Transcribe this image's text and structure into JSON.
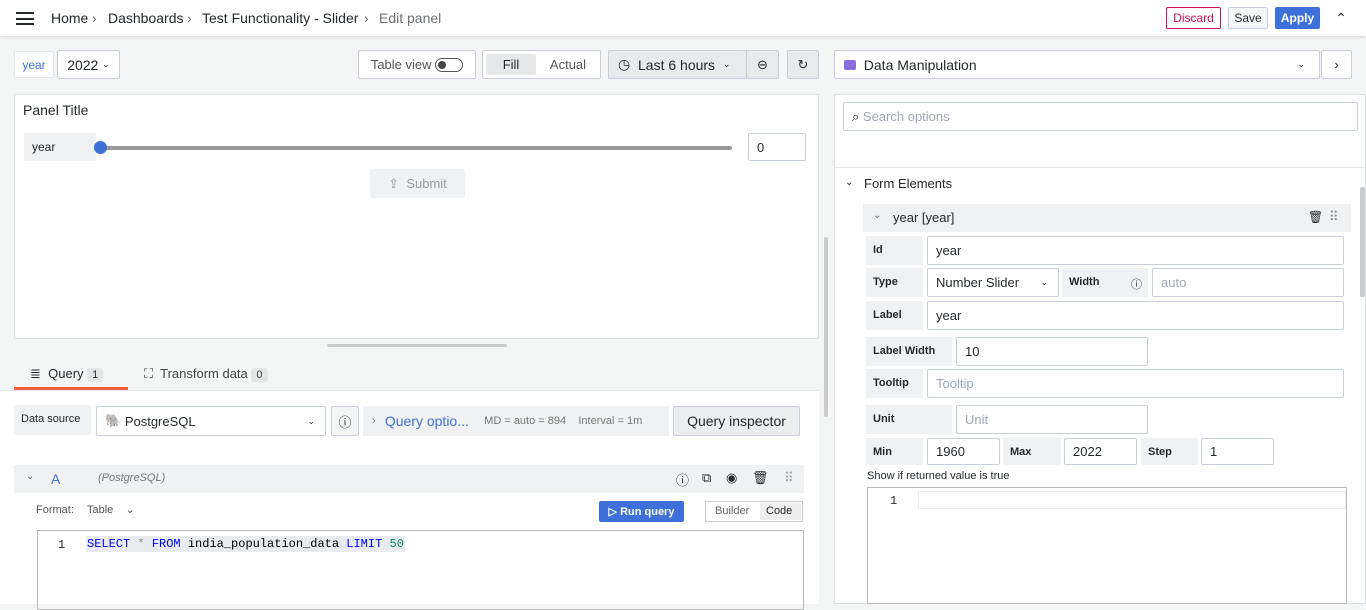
{
  "breadcrumb": {
    "items": [
      "Home",
      "Dashboards",
      "Test Functionality - Slider"
    ],
    "current": "Edit panel"
  },
  "header": {
    "discard": "Discard",
    "save": "Save",
    "apply": "Apply"
  },
  "toolbar": {
    "var_label": "year",
    "var_value": "2022",
    "table_view": "Table view",
    "fill": "Fill",
    "actual": "Actual",
    "time_range": "Last 6 hours"
  },
  "panel": {
    "title": "Panel Title",
    "slider_label": "year",
    "slider_value": "0",
    "submit": "Submit"
  },
  "tabs": {
    "query": "Query",
    "query_count": "1",
    "transform": "Transform data",
    "transform_count": "0"
  },
  "datasource": {
    "label": "Data source",
    "value": "PostgreSQL",
    "query_options": "Query optio...",
    "md": "MD = auto = 894",
    "interval": "Interval = 1m",
    "inspector": "Query inspector"
  },
  "query": {
    "ref": "A",
    "ds": "(PostgreSQL)",
    "format_label": "Format:",
    "format_value": "Table",
    "run": "Run query",
    "builder": "Builder",
    "code": "Code",
    "line": "1",
    "sql": [
      {
        "t": "SELECT",
        "c": "#0000ff"
      },
      {
        "t": " * ",
        "c": "#888"
      },
      {
        "t": "FROM",
        "c": "#0000ff"
      },
      {
        "t": " india_population_data ",
        "c": "#000"
      },
      {
        "t": "LIMIT",
        "c": "#0000ff"
      },
      {
        "t": " 50",
        "c": "#09885a"
      }
    ]
  },
  "options": {
    "viz": "Data Manipulation",
    "search_placeholder": "Search options",
    "section": "Form Elements",
    "element": "year [year]",
    "id_label": "Id",
    "id_value": "year",
    "type_label": "Type",
    "type_value": "Number Slider",
    "width_label": "Width",
    "width_placeholder": "auto",
    "label_label": "Label",
    "label_value": "year",
    "labelwidth_label": "Label Width",
    "labelwidth_value": "10",
    "tooltip_label": "Tooltip",
    "tooltip_placeholder": "Tooltip",
    "unit_label": "Unit",
    "unit_placeholder": "Unit",
    "min_label": "Min",
    "min_value": "1960",
    "max_label": "Max",
    "max_value": "2022",
    "step_label": "Step",
    "step_value": "1",
    "show_if": "Show if returned value is true",
    "editor_line": "1"
  },
  "colors": {
    "accent": "#3d71d9",
    "discard": "#d10e5c",
    "tab_active": "#f55f3e"
  }
}
